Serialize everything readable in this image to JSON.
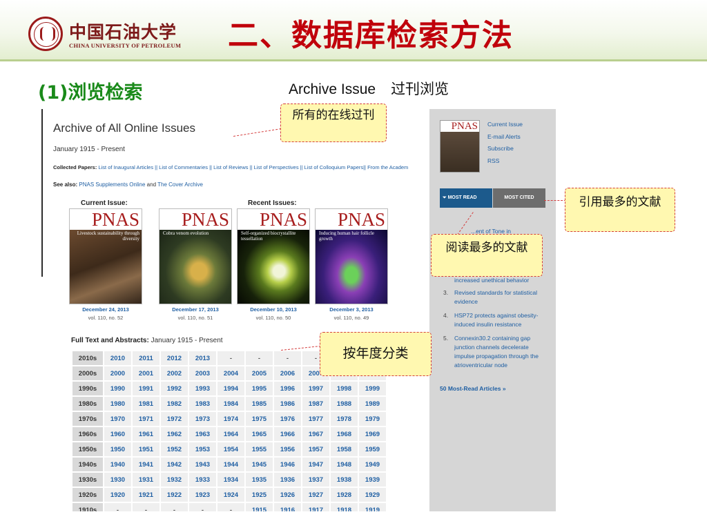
{
  "header": {
    "university_cn": "中国石油大学",
    "university_en": "CHINA UNIVERSITY OF PETROLEUM",
    "slide_title": "二、数据库检索方法"
  },
  "subheading": "(1)浏览检索",
  "archive_caption": {
    "en": "Archive Issue",
    "cn": "过刊浏览"
  },
  "pnas_page": {
    "title": "Archive of All Online Issues",
    "range": "January 1915 - Present",
    "collected_label": "Collected Papers:",
    "collected_links": "List of Inaugural Articles || List of Commentaries || List of Reviews || List of Perspectives || List of Colloquium Papers|| From the Academ",
    "see_also_label": "See also:",
    "see_also_link1": "PNAS Supplements Online",
    "see_also_and": "and",
    "see_also_link2": "The Cover Archive",
    "current_issue_label": "Current Issue:",
    "recent_issues_label": "Recent Issues:",
    "covers": [
      {
        "masthead": "PNAS",
        "cover_text": "Livestock sustainability through diversity",
        "date": "December 24, 2013",
        "vol": "vol. 110, no. 52"
      },
      {
        "masthead": "PNAS",
        "cover_text": "Cobra venom evolution",
        "date": "December 17, 2013",
        "vol": "vol. 110, no. 51"
      },
      {
        "masthead": "PNAS",
        "cover_text": "Self-organized biocrystallite tessellation",
        "date": "December 10, 2013",
        "vol": "vol. 110, no. 50"
      },
      {
        "masthead": "PNAS",
        "cover_text": "Inducing human hair follicle growth",
        "date": "December 3, 2013",
        "vol": "vol. 110, no. 49"
      }
    ],
    "fulltext_label": "Full Text and Abstracts:",
    "fulltext_range": "January 1915 - Present",
    "year_grid": [
      [
        "2010s",
        "2010",
        "2011",
        "2012",
        "2013",
        "-",
        "-",
        "-",
        "-",
        "",
        ""
      ],
      [
        "2000s",
        "2000",
        "2001",
        "2002",
        "2003",
        "2004",
        "2005",
        "2006",
        "2007",
        "",
        ""
      ],
      [
        "1990s",
        "1990",
        "1991",
        "1992",
        "1993",
        "1994",
        "1995",
        "1996",
        "1997",
        "1998",
        "1999"
      ],
      [
        "1980s",
        "1980",
        "1981",
        "1982",
        "1983",
        "1984",
        "1985",
        "1986",
        "1987",
        "1988",
        "1989"
      ],
      [
        "1970s",
        "1970",
        "1971",
        "1972",
        "1973",
        "1974",
        "1975",
        "1976",
        "1977",
        "1978",
        "1979"
      ],
      [
        "1960s",
        "1960",
        "1961",
        "1962",
        "1963",
        "1964",
        "1965",
        "1966",
        "1967",
        "1968",
        "1969"
      ],
      [
        "1950s",
        "1950",
        "1951",
        "1952",
        "1953",
        "1954",
        "1955",
        "1956",
        "1957",
        "1958",
        "1959"
      ],
      [
        "1940s",
        "1940",
        "1941",
        "1942",
        "1943",
        "1944",
        "1945",
        "1946",
        "1947",
        "1948",
        "1949"
      ],
      [
        "1930s",
        "1930",
        "1931",
        "1932",
        "1933",
        "1934",
        "1935",
        "1936",
        "1937",
        "1938",
        "1939"
      ],
      [
        "1920s",
        "1920",
        "1921",
        "1922",
        "1923",
        "1924",
        "1925",
        "1926",
        "1927",
        "1928",
        "1929"
      ],
      [
        "1910s",
        "-",
        "-",
        "-",
        "-",
        "-",
        "1915",
        "1916",
        "1917",
        "1918",
        "1919"
      ]
    ]
  },
  "sidebar": {
    "cover_masthead": "PNAS",
    "links": [
      "Current Issue",
      "E-mail Alerts",
      "Subscribe",
      "RSS"
    ],
    "tab_most_read": "MOST READ",
    "tab_most_cited": "MOST CITED",
    "frag_top": "...ent of Tone in",
    "frag_mid": "increased unethical behavior",
    "list": [
      {
        "num": "3.",
        "text": "Revised standards for statistical evidence"
      },
      {
        "num": "4.",
        "text": "HSP72 protects against obesity-induced insulin resistance"
      },
      {
        "num": "5.",
        "text": "Connexin30.2 containing gap junction channels decelerate impulse propagation through the atrioventricular node"
      }
    ],
    "more_link": "50 Most-Read Articles »"
  },
  "callouts": {
    "all_issues": "所有的在线过刊",
    "most_cited": "引用最多的文献",
    "most_read": "阅读最多的文献",
    "by_year": "按年度分类"
  },
  "colors": {
    "title_red": "#c0000b",
    "subheading_green": "#1a8a1a",
    "link_blue": "#1f5fa3",
    "callout_fill": "#fff8b0",
    "callout_border": "#d43c3c"
  }
}
